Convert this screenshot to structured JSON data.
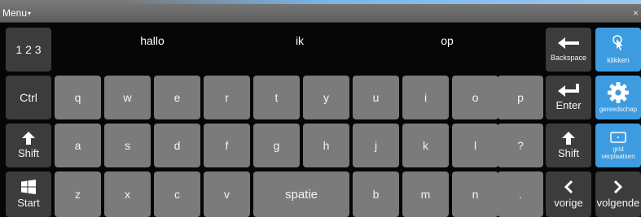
{
  "topbar": {
    "menu_label": "Menu",
    "menu_caret": "▾",
    "close_label": "×"
  },
  "suggestions": {
    "numbers_key": "1 2 3",
    "words": [
      "hallo",
      "ik",
      "op"
    ]
  },
  "keys": {
    "row2": [
      "q",
      "w",
      "e",
      "r",
      "t",
      "y",
      "u",
      "i",
      "o",
      "p"
    ],
    "row3": [
      "a",
      "s",
      "d",
      "f",
      "g",
      "h",
      "j",
      "k",
      "l",
      "?"
    ],
    "row4": [
      "z",
      "x",
      "c",
      "v",
      "b",
      "m",
      "n",
      "."
    ],
    "space": "spatie"
  },
  "modifiers": {
    "ctrl": "Ctrl",
    "shift_left": "Shift",
    "start": "Start",
    "backspace": "Backspace",
    "enter": "Enter",
    "shift_right": "Shift",
    "prev": "vorige",
    "next": "volgende"
  },
  "tools": {
    "click": "klikken",
    "tool": "gereedschap",
    "grid_move_1": "grid",
    "grid_move_2": "verplaatsen"
  },
  "icons": {
    "backspace": "arrow-left-icon",
    "enter": "enter-arrow-icon",
    "shift": "up-arrow-icon",
    "start": "windows-icon",
    "click": "pointer-icon",
    "tool": "gear-icon",
    "grid": "grid-frame-icon",
    "prev": "chevron-left-icon",
    "next": "chevron-right-icon"
  },
  "colors": {
    "key": "#7b7b7b",
    "dark_key": "#3c3c3c",
    "accent": "#3d9ce0",
    "background": "#060606"
  }
}
